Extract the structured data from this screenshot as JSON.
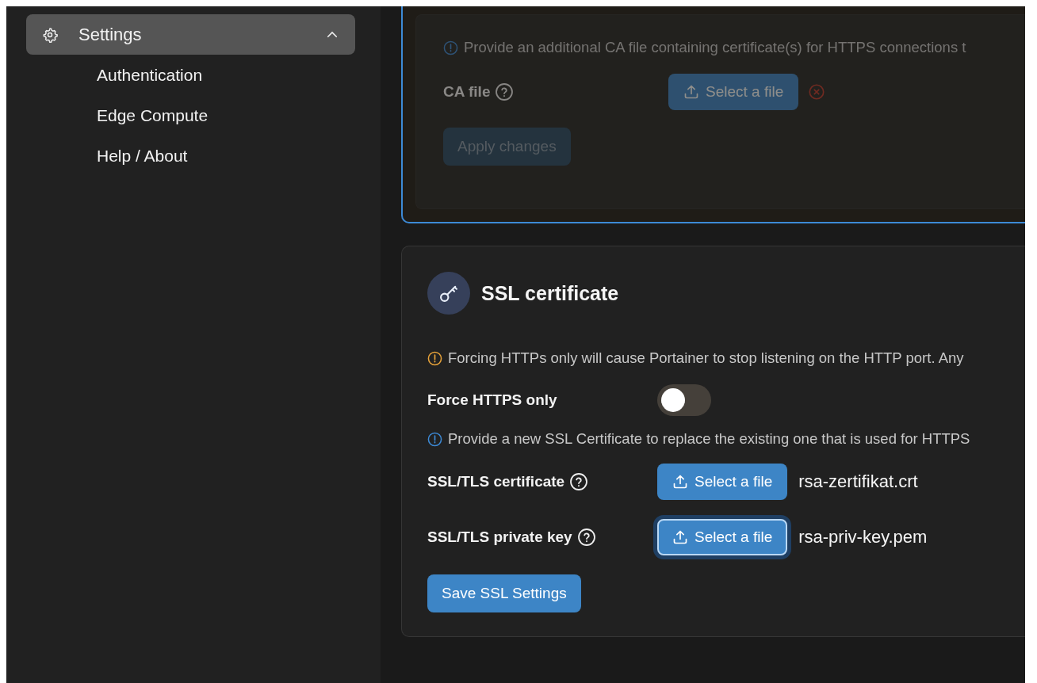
{
  "sidebar": {
    "section": {
      "label": "Settings",
      "expanded": true,
      "selected": true
    },
    "items": [
      {
        "label": "Authentication"
      },
      {
        "label": "Edge Compute"
      },
      {
        "label": "Help / About"
      }
    ]
  },
  "ca_panel": {
    "dimmed": true,
    "info": "Provide an additional CA file containing certificate(s) for HTTPS connections t",
    "field": {
      "label": "CA file",
      "button": "Select a file"
    },
    "apply_button": {
      "label": "Apply changes",
      "disabled": true
    }
  },
  "ssl_card": {
    "title": "SSL certificate",
    "warning": "Forcing HTTPs only will cause Portainer to stop listening on the HTTP port. Any",
    "force_https": {
      "label": "Force HTTPS only",
      "on": false
    },
    "info": "Provide a new SSL Certificate to replace the existing one that is used for HTTPS",
    "files": [
      {
        "label": "SSL/TLS certificate",
        "button": "Select a file",
        "file_name": "rsa-zertifikat.crt",
        "focused": false
      },
      {
        "label": "SSL/TLS private key",
        "button": "Select a file",
        "file_name": "rsa-priv-key.pem",
        "focused": true
      }
    ],
    "save_button": "Save SSL Settings"
  }
}
